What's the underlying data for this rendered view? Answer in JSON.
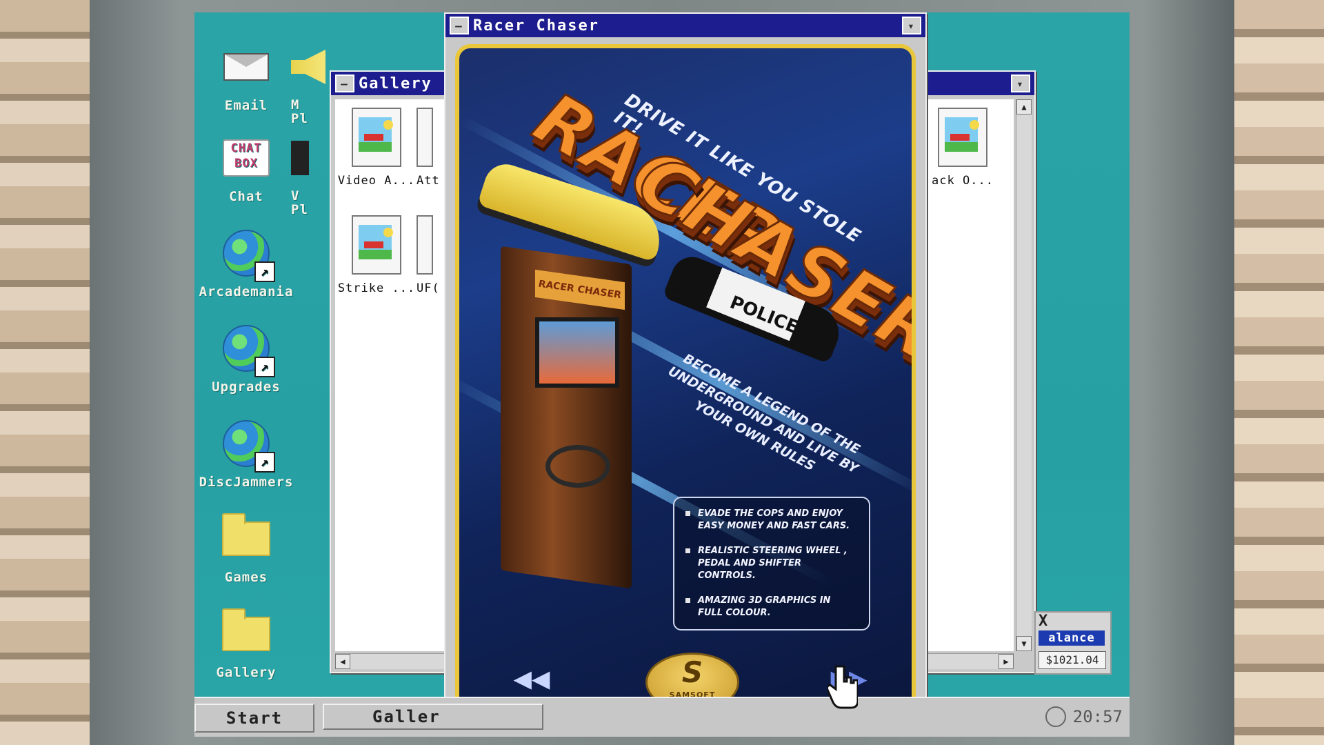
{
  "desktop": {
    "icons": [
      {
        "label": "Email",
        "icon": "envelope-icon"
      },
      {
        "label": "Chat",
        "icon": "chat-box-icon"
      },
      {
        "label": "Arcademania",
        "icon": "globe-shortcut-icon"
      },
      {
        "label": "Upgrades",
        "icon": "globe-shortcut-icon"
      },
      {
        "label": "DiscJammers",
        "icon": "globe-shortcut-icon"
      },
      {
        "label": "Games",
        "icon": "folder-icon"
      },
      {
        "label": "Gallery",
        "icon": "folder-icon"
      }
    ],
    "partial_icons": [
      {
        "label": "M\nPl",
        "icon": "speaker-icon"
      },
      {
        "label": "V\nPl",
        "icon": "video-icon"
      }
    ]
  },
  "gallery_window": {
    "title": "Gallery",
    "items": [
      {
        "label": "Video A..."
      },
      {
        "label": "Att"
      },
      {
        "label": "Strike ..."
      },
      {
        "label": "UF("
      },
      {
        "label": "ack O..."
      }
    ]
  },
  "poster_window": {
    "title": "Racer Chaser",
    "tagline": "DRIVE IT LIKE YOU STOLE IT!",
    "logo_line1": "RACER",
    "logo_line2": "CHASER",
    "marquee": "RACER CHASER",
    "police_text": "POLICE",
    "slogan": "BECOME A LEGEND OF THE UNDERGROUND AND LIVE BY YOUR OWN RULES",
    "features": [
      "EVADE THE COPS AND ENJOY EASY MONEY AND FAST CARS.",
      "REALISTIC STEERING WHEEL , PEDAL AND SHIFTER CONTROLS.",
      "AMAZING 3D GRAPHICS IN FULL COLOUR."
    ],
    "publisher": "SAMSOFT"
  },
  "balance_widget": {
    "label": "alance",
    "value": "$1021.04",
    "close": "X"
  },
  "taskbar": {
    "start_label": "Start",
    "items": [
      {
        "label": "Galler"
      }
    ],
    "clock": "20:57"
  }
}
